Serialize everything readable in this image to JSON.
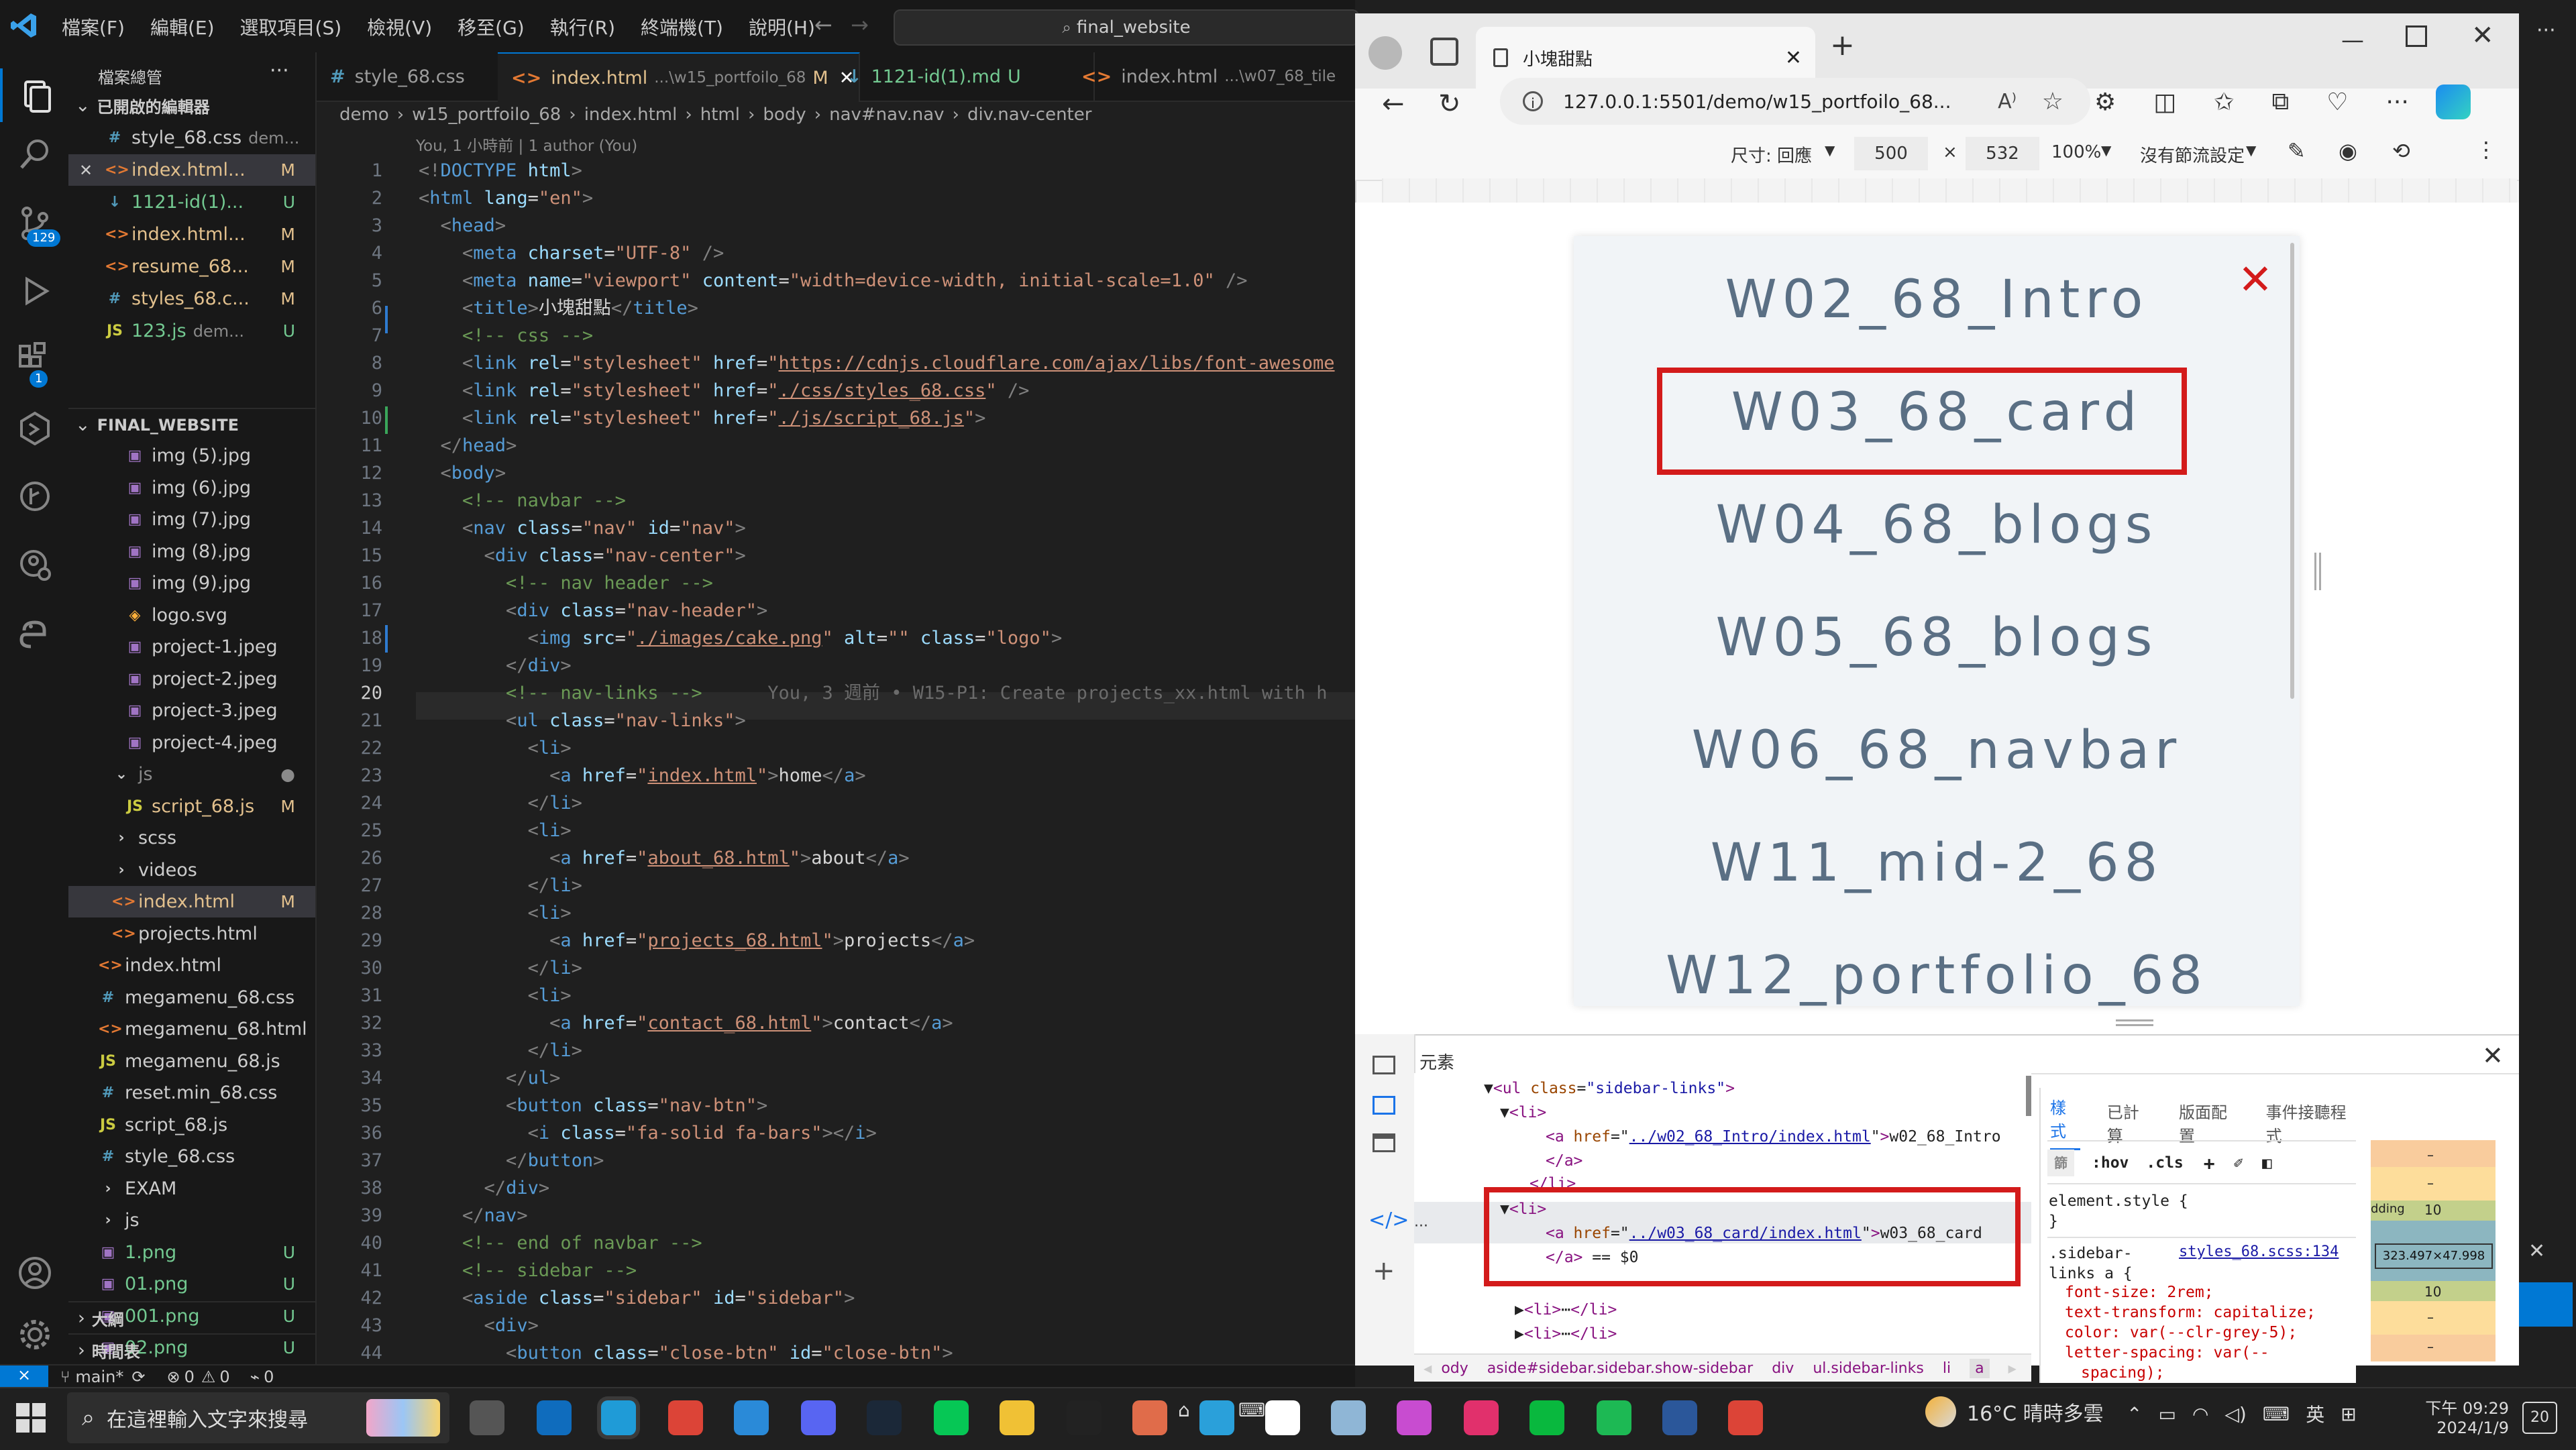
{
  "vscode": {
    "menu": [
      "檔案(F)",
      "編輯(E)",
      "選取項目(S)",
      "檢視(V)",
      "移至(G)",
      "執行(R)",
      "終端機(T)",
      "說明(H)"
    ],
    "search_text": "final_website",
    "explorer": {
      "title": "檔案總管",
      "open_editors_header": "已開啟的編輯器",
      "open_editors": [
        {
          "name": "style_68.css",
          "extra": "dem...",
          "status": "",
          "type": "css"
        },
        {
          "name": "index.html...",
          "extra": "",
          "status": "M",
          "type": "html"
        },
        {
          "name": "1121-id(1)...",
          "extra": "",
          "status": "U",
          "type": "md"
        },
        {
          "name": "index.html...",
          "extra": "",
          "status": "M",
          "type": "html"
        },
        {
          "name": "resume_68...",
          "extra": "",
          "status": "M",
          "type": "html"
        },
        {
          "name": "styles_68.c...",
          "extra": "",
          "status": "M",
          "type": "css"
        },
        {
          "name": "123.js",
          "extra": "dem...",
          "status": "U",
          "type": "js"
        }
      ],
      "workspace_header": "FINAL_WEBSITE",
      "tree": [
        {
          "name": "img (5).jpg",
          "status": "",
          "type": "img",
          "indent": 2
        },
        {
          "name": "img (6).jpg",
          "status": "",
          "type": "img",
          "indent": 2
        },
        {
          "name": "img (7).jpg",
          "status": "",
          "type": "img",
          "indent": 2
        },
        {
          "name": "img (8).jpg",
          "status": "",
          "type": "img",
          "indent": 2
        },
        {
          "name": "img (9).jpg",
          "status": "",
          "type": "img",
          "indent": 2
        },
        {
          "name": "logo.svg",
          "status": "",
          "type": "svg",
          "indent": 2
        },
        {
          "name": "project-1.jpeg",
          "status": "",
          "type": "img",
          "indent": 2
        },
        {
          "name": "project-2.jpeg",
          "status": "",
          "type": "img",
          "indent": 2
        },
        {
          "name": "project-3.jpeg",
          "status": "",
          "type": "img",
          "indent": 2
        },
        {
          "name": "project-4.jpeg",
          "status": "",
          "type": "img",
          "indent": 2
        },
        {
          "name": "js",
          "status": "●",
          "type": "folder-open",
          "indent": 1
        },
        {
          "name": "script_68.js",
          "status": "M",
          "type": "js",
          "indent": 2
        },
        {
          "name": "scss",
          "status": "",
          "type": "folder",
          "indent": 1
        },
        {
          "name": "videos",
          "status": "",
          "type": "folder",
          "indent": 1
        },
        {
          "name": "index.html",
          "status": "M",
          "type": "html",
          "indent": 1
        },
        {
          "name": "projects.html",
          "status": "",
          "type": "html",
          "indent": 1
        },
        {
          "name": "index.html",
          "status": "",
          "type": "html",
          "indent": 0
        },
        {
          "name": "megamenu_68.css",
          "status": "",
          "type": "css",
          "indent": 0
        },
        {
          "name": "megamenu_68.html",
          "status": "",
          "type": "html",
          "indent": 0
        },
        {
          "name": "megamenu_68.js",
          "status": "",
          "type": "js",
          "indent": 0
        },
        {
          "name": "reset.min_68.css",
          "status": "",
          "type": "css",
          "indent": 0
        },
        {
          "name": "script_68.js",
          "status": "",
          "type": "js",
          "indent": 0
        },
        {
          "name": "style_68.css",
          "status": "",
          "type": "css",
          "indent": 0
        },
        {
          "name": "EXAM",
          "status": "",
          "type": "folder",
          "indent": 0
        },
        {
          "name": "js",
          "status": "",
          "type": "folder",
          "indent": 0
        },
        {
          "name": "1.png",
          "status": "U",
          "type": "png",
          "indent": 0
        },
        {
          "name": "01.png",
          "status": "U",
          "type": "png",
          "indent": 0
        },
        {
          "name": "001.png",
          "status": "U",
          "type": "png",
          "indent": 0
        },
        {
          "name": "02.png",
          "status": "U",
          "type": "png",
          "indent": 0
        }
      ],
      "outline": "大綱",
      "timeline": "時間表"
    },
    "tabs": [
      {
        "icon": "#",
        "label": "style_68.css",
        "path": "",
        "status": "",
        "active": false
      },
      {
        "icon": "<>",
        "label": "index.html",
        "path": "...\\w15_portfoilo_68",
        "status": "M",
        "active": true
      },
      {
        "icon": "↓",
        "label": "1121-id(1).md",
        "path": "",
        "status": "U",
        "active": false
      },
      {
        "icon": "<>",
        "label": "index.html",
        "path": "...\\w07_68_tile",
        "status": "",
        "active": false
      }
    ],
    "breadcrumbs": [
      "demo",
      "w15_portfoilo_68",
      "index.html",
      "html",
      "body",
      "nav#nav.nav",
      "div.nav-center"
    ],
    "blame": "You, 1 小時前 | 1 author (You)",
    "inline_blame": "You, 3 週前 • W15-P1: Create projects_xx.html with h",
    "status": {
      "branch": "main*",
      "errors": "0",
      "warnings": "0",
      "ports": "0"
    }
  },
  "browser": {
    "tab_title": "小塊甜點",
    "url": "127.0.0.1:5501/demo/w15_portfoilo_68...",
    "device_toolbar": {
      "size_label": "尺寸: 回應",
      "width": "500",
      "height": "532",
      "zoom": "100%",
      "throttle": "沒有節流設定"
    },
    "sidebar_links": [
      "W02_68_Intro",
      "W03_68_card",
      "W04_68_blogs",
      "W05_68_blogs",
      "W06_68_navbar",
      "W11_mid-2_68",
      "W12_portfolio_68"
    ],
    "close_symbol": "✕",
    "devtools": {
      "panel_title": "元素",
      "style_tabs": [
        "樣式",
        "已計算",
        "版面配置",
        "事件接聽程式"
      ],
      "filter_placeholder": "篩",
      "hov": ":hov",
      "cls": ".cls",
      "element_style": "element.style {",
      "rule_selector": ".sidebar-links a {",
      "rule_source": "styles_68.scss:134",
      "rule_lines": [
        "font-size: 2rem;",
        "text-transform: capitalize;",
        "color: var(--clr-grey-5);",
        "letter-spacing: var(--",
        "spacing);"
      ],
      "crumbs": [
        "ody",
        "aside#sidebar.sidebar.show-sidebar",
        "div",
        "ul.sidebar-links",
        "li",
        "a"
      ],
      "box": {
        "size": "323.497×47.998",
        "padding_label": "dding",
        "padding_top": "10",
        "padding_bottom": "10",
        "dash": "–"
      }
    }
  },
  "taskbar": {
    "search_placeholder": "在這裡輸入文字來搜尋",
    "weather": "16°C 晴時多雲",
    "ime": "英",
    "time": "下午 09:29",
    "date": "2024/1/9",
    "notif_count": "20"
  }
}
